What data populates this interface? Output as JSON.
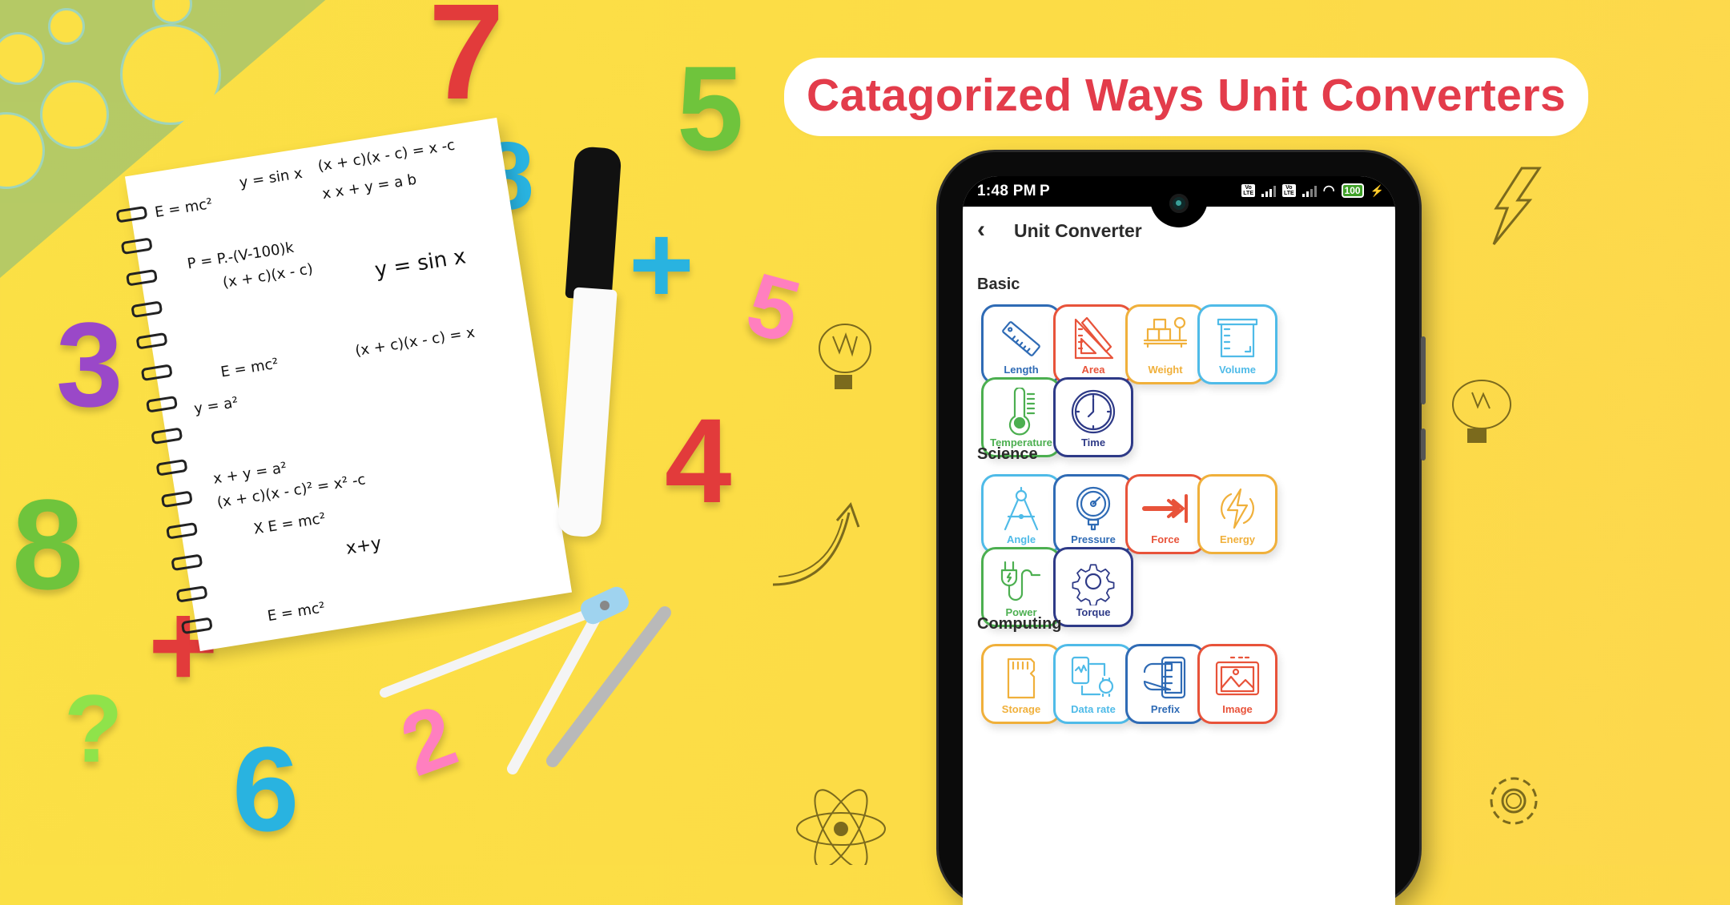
{
  "headline": "Catagorized Ways Unit Converters",
  "phone": {
    "status_bar": {
      "time": "1:48 PM",
      "notification_icon": "parking-p-icon",
      "sim1": "VoLTE",
      "sim2": "VoLTE",
      "wifi": "wifi-icon",
      "battery": "100",
      "charging": true
    },
    "app_bar": {
      "back_icon": "chevron-left-icon",
      "title": "Unit Converter"
    },
    "sections": [
      {
        "title": "Basic",
        "items": [
          {
            "label": "Length",
            "icon": "ruler-icon",
            "color": "#2f6bb5"
          },
          {
            "label": "Area",
            "icon": "set-square-pencil-icon",
            "color": "#e8533a"
          },
          {
            "label": "Weight",
            "icon": "scale-boxes-icon",
            "color": "#f0b03b"
          },
          {
            "label": "Volume",
            "icon": "beaker-icon",
            "color": "#4fbbe8"
          },
          {
            "label": "Temperature",
            "icon": "thermometer-icon",
            "color": "#4caf50"
          },
          {
            "label": "Time",
            "icon": "clock-icon",
            "color": "#2e3a87"
          }
        ]
      },
      {
        "title": "Science",
        "items": [
          {
            "label": "Angle",
            "icon": "compass-icon",
            "color": "#4fbbe8"
          },
          {
            "label": "Pressure",
            "icon": "pressure-gauge-icon",
            "color": "#2f6bb5"
          },
          {
            "label": "Force",
            "icon": "arrow-to-bar-icon",
            "color": "#e8533a"
          },
          {
            "label": "Energy",
            "icon": "lightning-circle-icon",
            "color": "#f0b03b"
          },
          {
            "label": "Power",
            "icon": "plug-icon",
            "color": "#4caf50"
          },
          {
            "label": "Torque",
            "icon": "gear-icon",
            "color": "#2e3a87"
          }
        ]
      },
      {
        "title": "Computing",
        "items": [
          {
            "label": "Storage",
            "icon": "sd-card-icon",
            "color": "#f0b03b"
          },
          {
            "label": "Data rate",
            "icon": "phone-watch-sync-icon",
            "color": "#4fbbe8"
          },
          {
            "label": "Prefix",
            "icon": "hand-phone-icon",
            "color": "#2f6bb5"
          },
          {
            "label": "Image",
            "icon": "picture-icon",
            "color": "#e8533a"
          }
        ]
      }
    ]
  },
  "background": {
    "numbers": [
      "7",
      "5",
      "8",
      "3",
      "5",
      "4",
      "8",
      "6",
      "2",
      "+",
      "+",
      "+",
      "?"
    ],
    "notebook_formulas": [
      "E = mc²",
      "y = sin x",
      "(x + c)(x - c) = x  -c",
      "x   x + y = a b",
      "P = P.-(V-100)k",
      "(x + c)(x - c)",
      "y = sin x",
      "E = mc²",
      "y = a²",
      "(x + c)(x - c) = x",
      "x + y = a²",
      "(x + c)(x - c)² = x² -c",
      "X  E = mc²",
      "x+y",
      "E = mc²"
    ]
  }
}
